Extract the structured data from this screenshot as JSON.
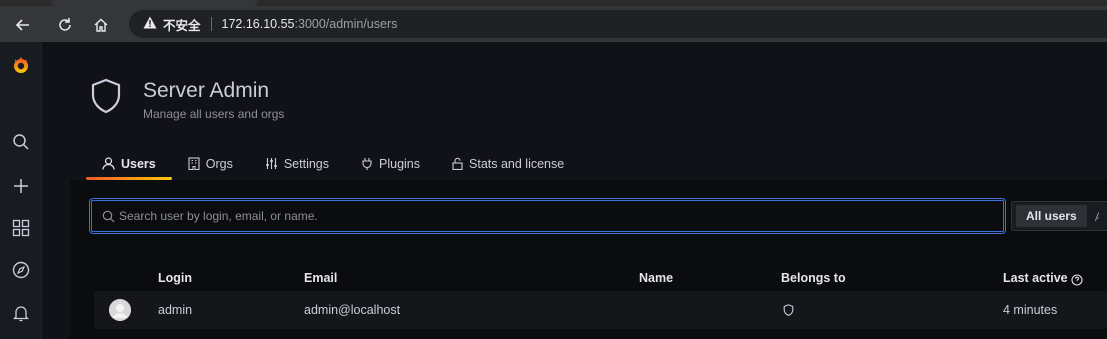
{
  "browser": {
    "security_label": "不安全",
    "url_host": "172.16.10.55",
    "url_path": ":3000/admin/users",
    "icons": [
      "back-icon",
      "reload-icon",
      "home-icon",
      "warning-icon"
    ]
  },
  "sidemenu": {
    "items": [
      "grafana-logo",
      "search-icon",
      "plus-icon",
      "dashboards-icon",
      "explore-icon",
      "alerting-icon"
    ]
  },
  "header": {
    "title": "Server Admin",
    "subtitle": "Manage all users and orgs",
    "icon": "shield-icon"
  },
  "tabs": [
    {
      "label": "Users",
      "icon": "user-icon",
      "active": true
    },
    {
      "label": "Orgs",
      "icon": "building-icon",
      "active": false
    },
    {
      "label": "Settings",
      "icon": "sliders-icon",
      "active": false
    },
    {
      "label": "Plugins",
      "icon": "plug-icon",
      "active": false
    },
    {
      "label": "Stats and license",
      "icon": "lock-icon",
      "active": false
    }
  ],
  "search": {
    "placeholder": "Search user by login, email, or name.",
    "value": ""
  },
  "filter": {
    "selected": "All users"
  },
  "table": {
    "columns": [
      "Login",
      "Email",
      "Name",
      "Belongs to",
      "Last active"
    ],
    "rows": [
      {
        "login": "admin",
        "email": "admin@localhost",
        "name": "",
        "belongs_to_icon": "shield-icon",
        "last_active": "4 minutes"
      }
    ]
  },
  "colors": {
    "background": "#111217",
    "accent_blue": "#3d71d9",
    "tab_underline_start": "#f05a28",
    "tab_underline_end": "#fbca0a"
  }
}
